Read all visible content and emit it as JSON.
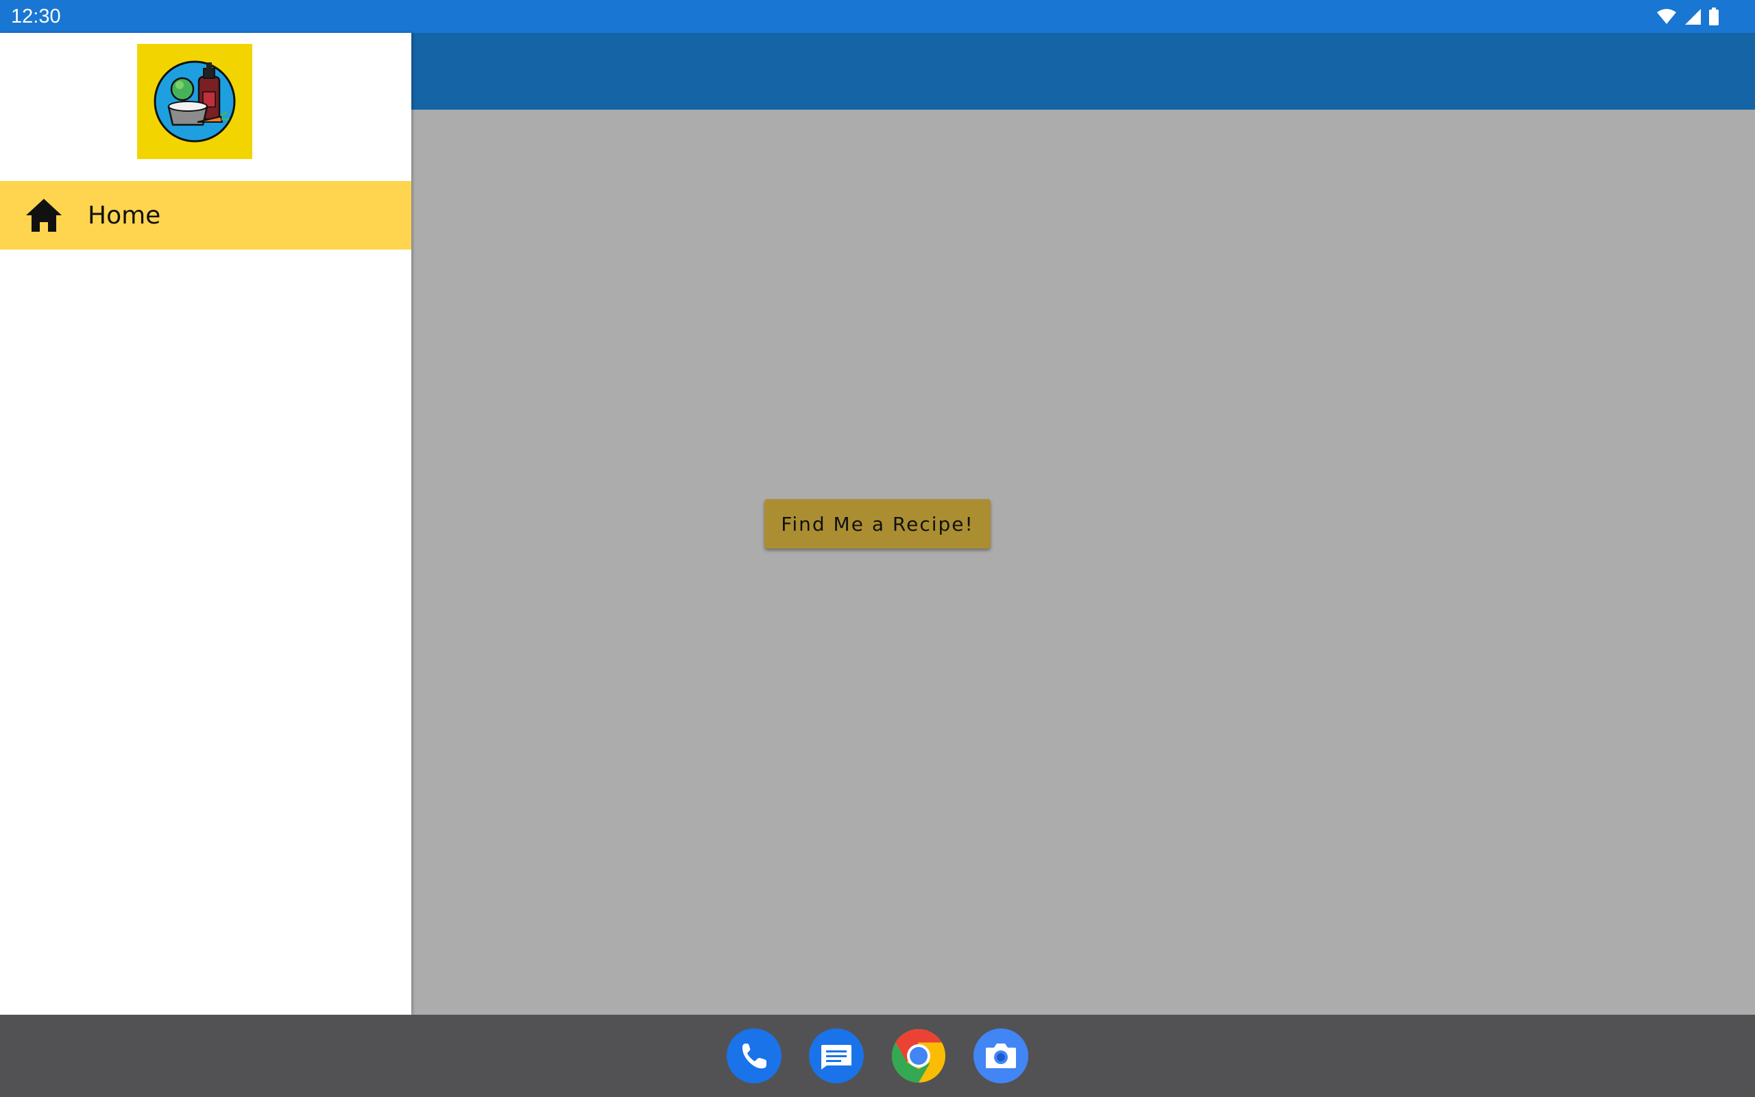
{
  "status_bar": {
    "time": "12:30",
    "color": "#1976d2",
    "icons": [
      "wifi-icon",
      "cellular-signal-icon",
      "battery-icon"
    ]
  },
  "app_bar": {
    "color": "#1565a6"
  },
  "drawer": {
    "logo": "recipe-app-logo",
    "items": [
      {
        "label": "Home",
        "icon": "home-icon",
        "selected": true,
        "highlight": "#ffd54f"
      }
    ]
  },
  "main": {
    "button_label": "Find Me a Recipe!",
    "button_color": "#ac8e32",
    "scrim_color": "#acacac"
  },
  "dock": {
    "apps": [
      {
        "name": "Phone",
        "icon": "phone-icon"
      },
      {
        "name": "Messages",
        "icon": "messages-icon"
      },
      {
        "name": "Chrome",
        "icon": "chrome-icon"
      },
      {
        "name": "Camera",
        "icon": "camera-icon"
      }
    ]
  }
}
